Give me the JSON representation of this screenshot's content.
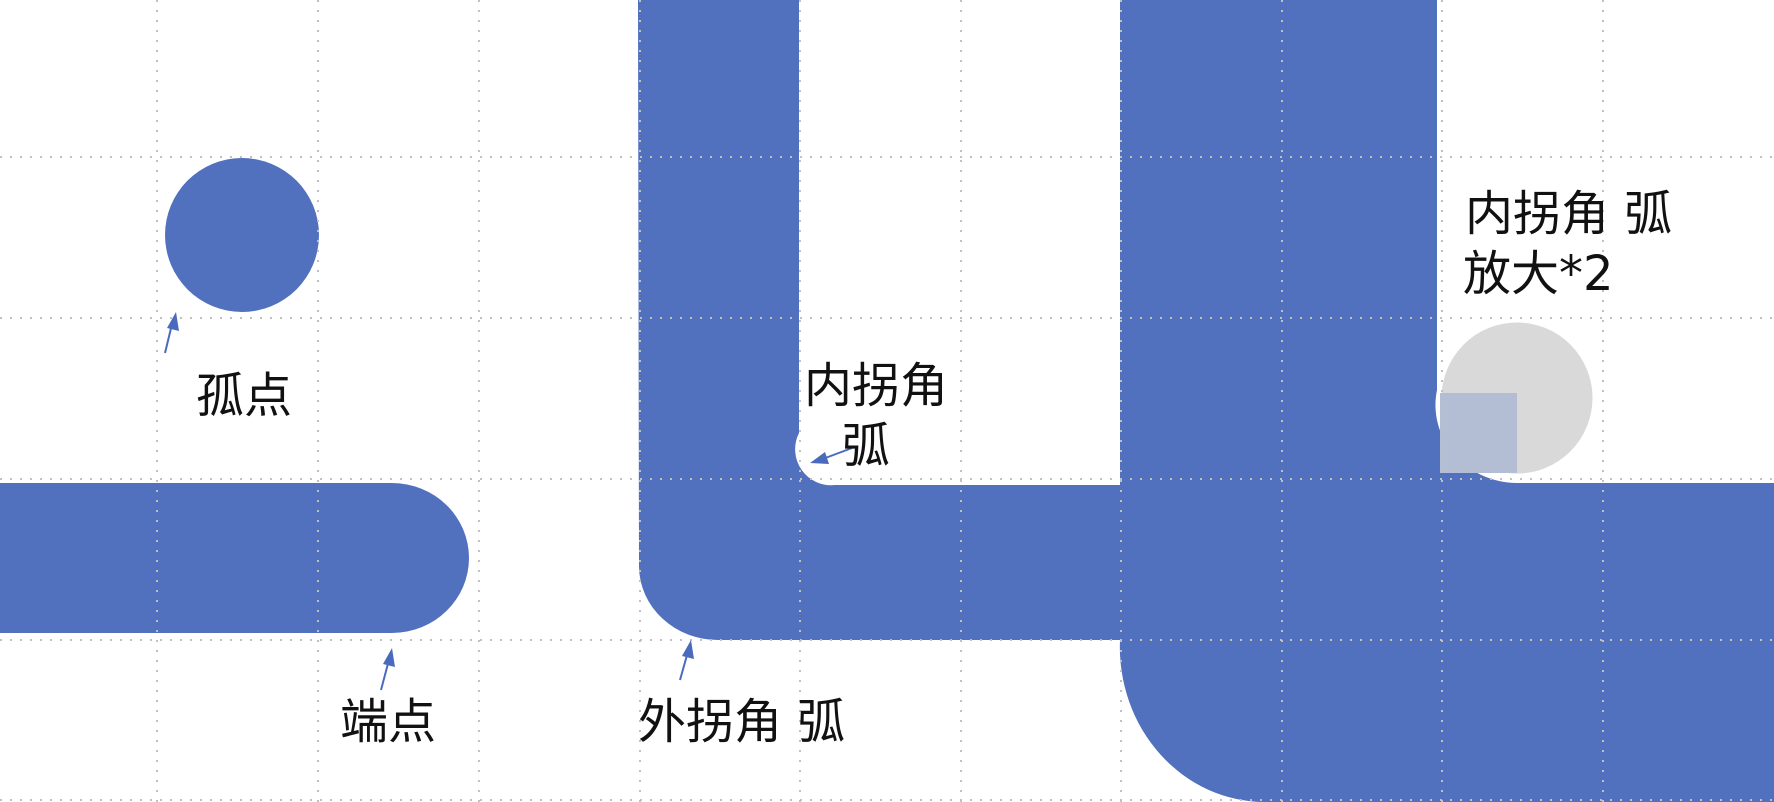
{
  "colors": {
    "shape_fill": "#5170be",
    "arrow": "#4a6bbd",
    "grid": "#c0c0c0",
    "magnifier_fill": "#d9d9d9",
    "magnifier_stroke": "#ffffff",
    "magnifier_overlay": "#b3bdd3",
    "text": "#111111"
  },
  "labels": {
    "isolated_point": "孤点",
    "end_point": "端点",
    "outer_corner_arc": "外拐角 弧",
    "inner_corner_arc_line1": "内拐角",
    "inner_corner_arc_line2": "弧",
    "zoomed_arc_line1": "内拐角 弧",
    "zoomed_arc_line2": "放大*2"
  },
  "icons": [
    "arrow-icon"
  ]
}
